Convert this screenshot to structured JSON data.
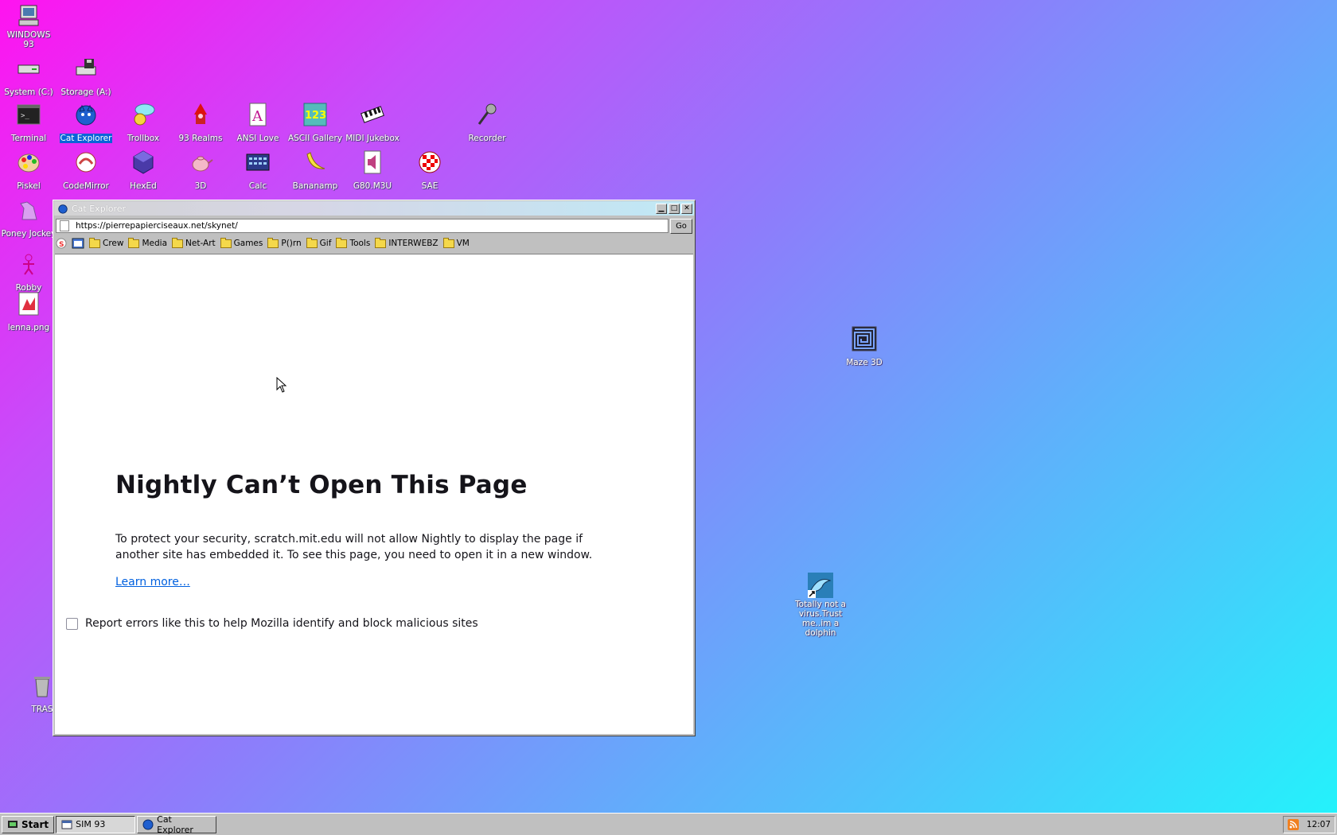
{
  "desktop": {
    "icons": [
      {
        "id": "windows93",
        "label": "WINDOWS 93",
        "icon": "computer-icon"
      },
      {
        "id": "system-c",
        "label": "System (C:)",
        "icon": "drive-icon"
      },
      {
        "id": "storage-a",
        "label": "Storage (A:)",
        "icon": "floppy-drive-icon"
      },
      {
        "id": "terminal",
        "label": "Terminal",
        "icon": "terminal-icon"
      },
      {
        "id": "cat-explorer",
        "label": "Cat Explorer",
        "icon": "globe-cat-icon"
      },
      {
        "id": "trollbox",
        "label": "Trollbox",
        "icon": "chat-icon"
      },
      {
        "id": "93realms",
        "label": "93 Realms",
        "icon": "wizard-icon"
      },
      {
        "id": "ansi-love",
        "label": "ANSI Love",
        "icon": "ansi-icon"
      },
      {
        "id": "ascii-gallery",
        "label": "ASCII Gallery",
        "icon": "ascii-icon"
      },
      {
        "id": "midi-jukebox",
        "label": "MIDI Jukebox",
        "icon": "piano-icon"
      },
      {
        "id": "recorder",
        "label": "Recorder",
        "icon": "microphone-icon"
      },
      {
        "id": "piskel",
        "label": "Piskel",
        "icon": "palette-icon"
      },
      {
        "id": "codemirror",
        "label": "CodeMirror",
        "icon": "codemirror-icon"
      },
      {
        "id": "hexed",
        "label": "HexEd",
        "icon": "hex-cube-icon"
      },
      {
        "id": "3d",
        "label": "3D",
        "icon": "teapot-icon"
      },
      {
        "id": "calc",
        "label": "Calc",
        "icon": "calculator-icon"
      },
      {
        "id": "bananamp",
        "label": "Bananamp",
        "icon": "banana-icon"
      },
      {
        "id": "g80m3u",
        "label": "G80.M3U",
        "icon": "audio-file-icon"
      },
      {
        "id": "sae",
        "label": "SAE",
        "icon": "ball-icon"
      },
      {
        "id": "poney-jockey",
        "label": "Poney Jockey",
        "icon": "pony-icon"
      },
      {
        "id": "robby",
        "label": "Robby",
        "icon": "robot-icon"
      },
      {
        "id": "lenna",
        "label": "lenna.png",
        "icon": "image-file-icon"
      },
      {
        "id": "trash",
        "label": "TRAS",
        "icon": "trash-icon"
      },
      {
        "id": "maze3d",
        "label": "Maze 3D",
        "icon": "maze-icon"
      },
      {
        "id": "dolphin",
        "label": "Totally not a virus.Trust me..im a dolphin",
        "icon": "dolphin-icon"
      }
    ]
  },
  "window": {
    "title": "Cat Explorer",
    "url": "https://pierrepapierciseaux.net/skynet/",
    "go_label": "Go",
    "bookmarks": [
      "Crew",
      "Media",
      "Net-Art",
      "Games",
      "P()rn",
      "Gif",
      "Tools",
      "INTERWEBZ",
      "VM"
    ],
    "error": {
      "title": "Nightly Can’t Open This Page",
      "body": "To protect your security, scratch.mit.edu will not allow Nightly to display the page if another site has embedded it. To see this page, you need to open it in a new window.",
      "learn_more": "Learn more…",
      "report_label": "Report errors like this to help Mozilla identify and block malicious sites"
    }
  },
  "taskbar": {
    "start_label": "Start",
    "tasks": [
      {
        "label": "SIM 93",
        "pressed": true
      },
      {
        "label": "Cat Explorer",
        "pressed": false
      }
    ],
    "clock": "12:07"
  }
}
